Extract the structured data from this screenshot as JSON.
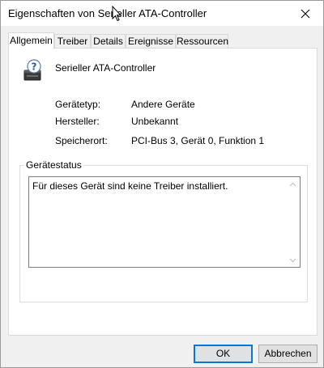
{
  "window": {
    "title": "Eigenschaften von Serieller ATA-Controller"
  },
  "titlebar": {
    "close_icon": "close-icon"
  },
  "tabs": [
    {
      "label": "Allgemein",
      "active": true
    },
    {
      "label": "Treiber",
      "active": false
    },
    {
      "label": "Details",
      "active": false
    },
    {
      "label": "Ereignisse",
      "active": false
    },
    {
      "label": "Ressourcen",
      "active": false
    }
  ],
  "general": {
    "device_name": "Serieller ATA-Controller",
    "device_icon": "unknown-device-icon",
    "properties": [
      {
        "label": "Gerätetyp:",
        "value": "Andere Geräte"
      },
      {
        "label": "Hersteller:",
        "value": "Unbekannt"
      },
      {
        "label": "Speicherort:",
        "value": "PCI-Bus 3, Gerät 0, Funktion 1"
      }
    ],
    "status_group_title": "Gerätestatus",
    "status_text": "Für dieses Gerät sind keine Treiber installiert."
  },
  "buttons": {
    "ok": "OK",
    "cancel": "Abbrechen"
  },
  "colors": {
    "accent": "#0078d7",
    "window_bg": "#f0f0f0",
    "panel_bg": "#ffffff"
  }
}
